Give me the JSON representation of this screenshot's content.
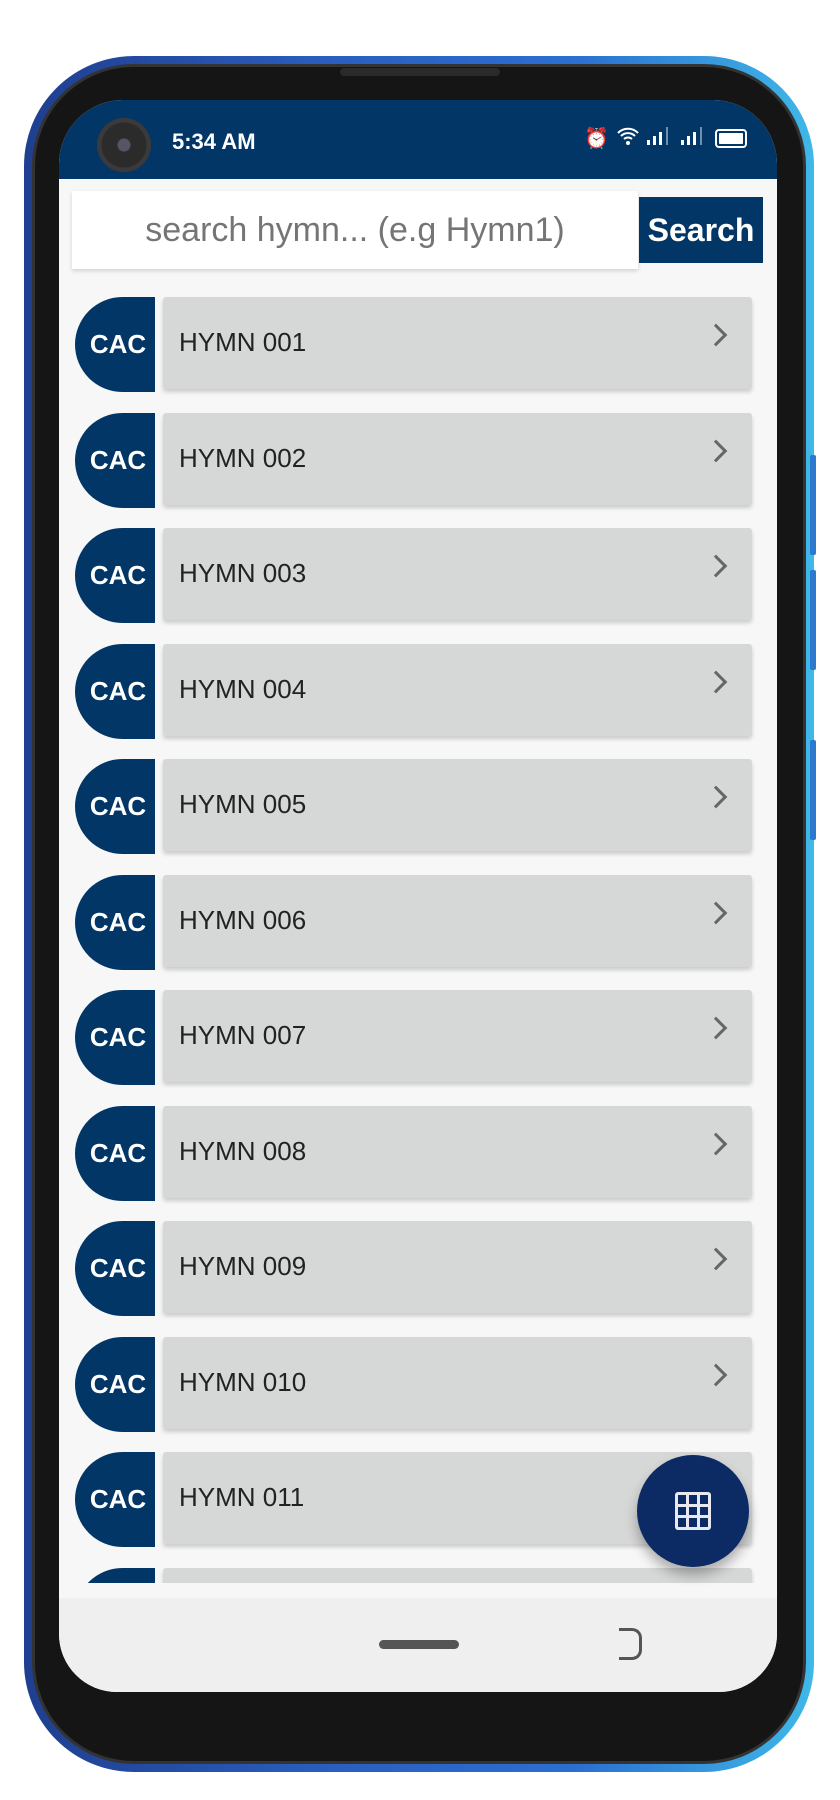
{
  "status_bar": {
    "time": "5:34 AM",
    "icons": [
      "alarm-icon",
      "wifi-icon",
      "signal-icon",
      "signal-icon",
      "battery-icon"
    ]
  },
  "search": {
    "placeholder": "search hymn... (e.g Hymn1)",
    "value": "",
    "button_label": "Search"
  },
  "hymns": [
    {
      "badge": "CAC",
      "label": "HYMN 001"
    },
    {
      "badge": "CAC",
      "label": "HYMN 002"
    },
    {
      "badge": "CAC",
      "label": "HYMN 003"
    },
    {
      "badge": "CAC",
      "label": "HYMN 004"
    },
    {
      "badge": "CAC",
      "label": "HYMN 005"
    },
    {
      "badge": "CAC",
      "label": "HYMN 006"
    },
    {
      "badge": "CAC",
      "label": "HYMN 007"
    },
    {
      "badge": "CAC",
      "label": "HYMN 008"
    },
    {
      "badge": "CAC",
      "label": "HYMN 009"
    },
    {
      "badge": "CAC",
      "label": "HYMN 010"
    },
    {
      "badge": "CAC",
      "label": "HYMN 011"
    },
    {
      "badge": "",
      "label": ""
    }
  ],
  "fab": {
    "icon": "keypad-grid-icon"
  },
  "colors": {
    "primary": "#023666",
    "card": "#d6d7d7",
    "fab": "#0c2a63"
  }
}
